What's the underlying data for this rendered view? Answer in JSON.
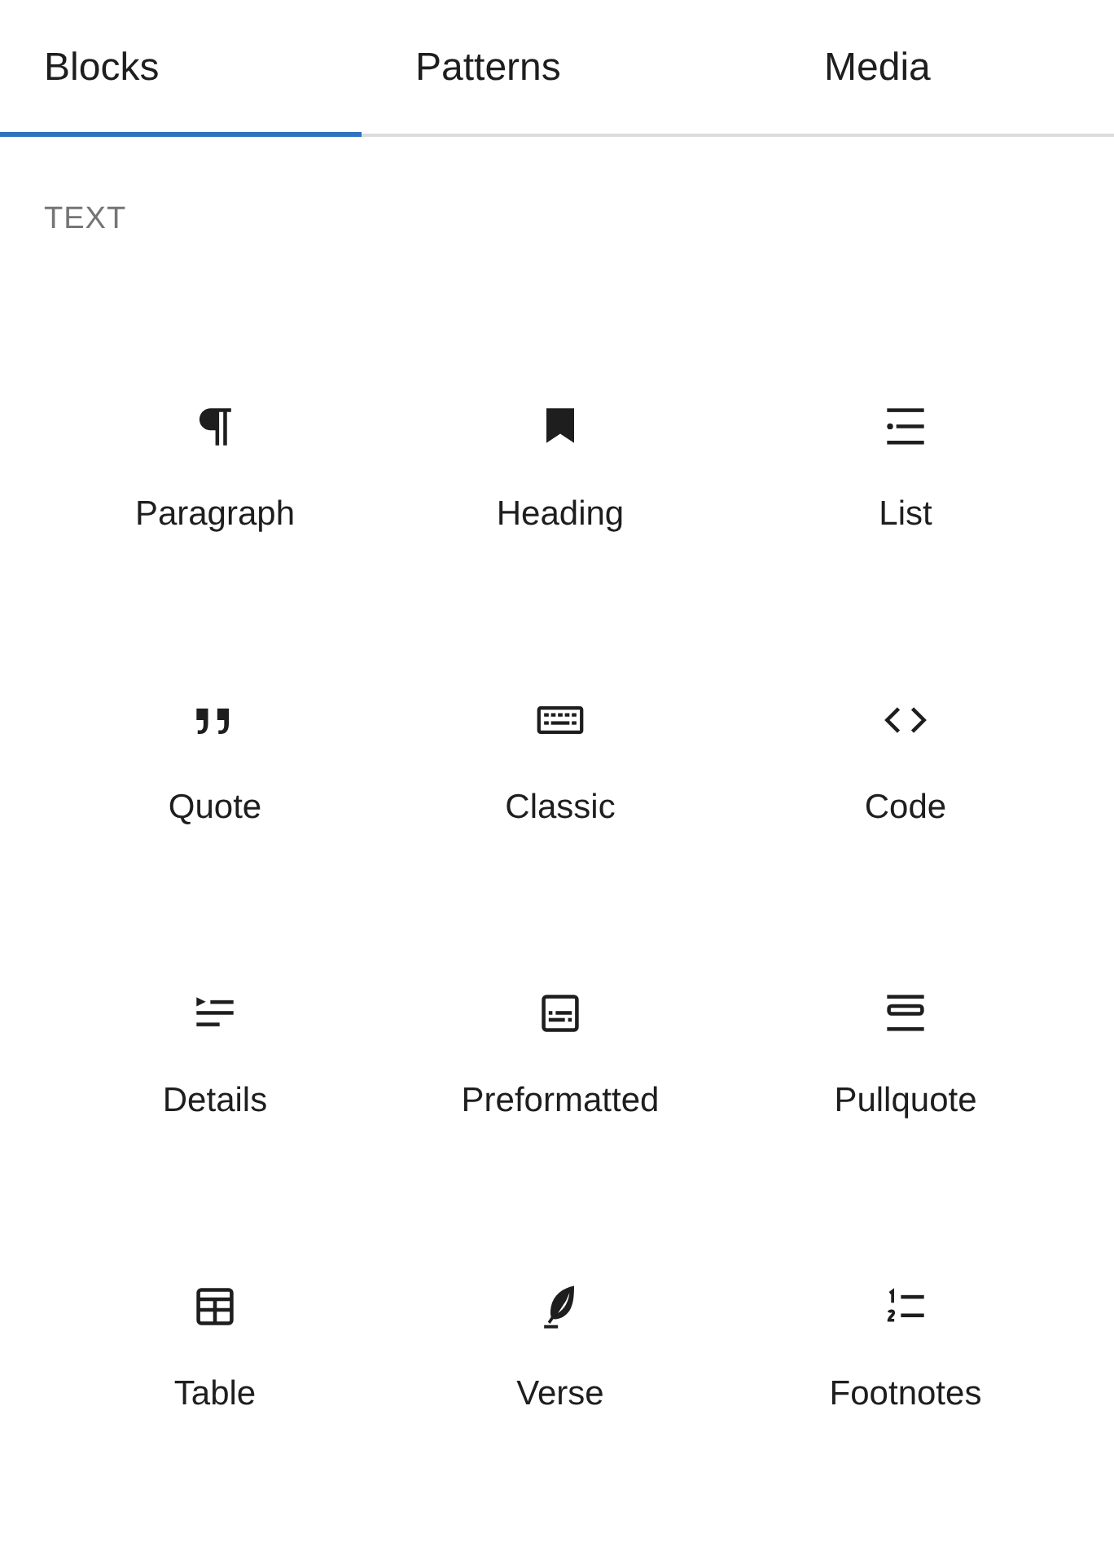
{
  "tabs": [
    {
      "label": "Blocks",
      "selected": true
    },
    {
      "label": "Patterns",
      "selected": false
    },
    {
      "label": "Media",
      "selected": false
    }
  ],
  "category": "TEXT",
  "blocks": [
    {
      "label": "Paragraph",
      "kind": "paragraph"
    },
    {
      "label": "Heading",
      "kind": "heading"
    },
    {
      "label": "List",
      "kind": "list"
    },
    {
      "label": "Quote",
      "kind": "quote"
    },
    {
      "label": "Classic",
      "kind": "classic"
    },
    {
      "label": "Code",
      "kind": "code"
    },
    {
      "label": "Details",
      "kind": "details"
    },
    {
      "label": "Preformatted",
      "kind": "preformatted"
    },
    {
      "label": "Pullquote",
      "kind": "pullquote"
    },
    {
      "label": "Table",
      "kind": "table"
    },
    {
      "label": "Verse",
      "kind": "verse"
    },
    {
      "label": "Footnotes",
      "kind": "footnotes"
    }
  ]
}
